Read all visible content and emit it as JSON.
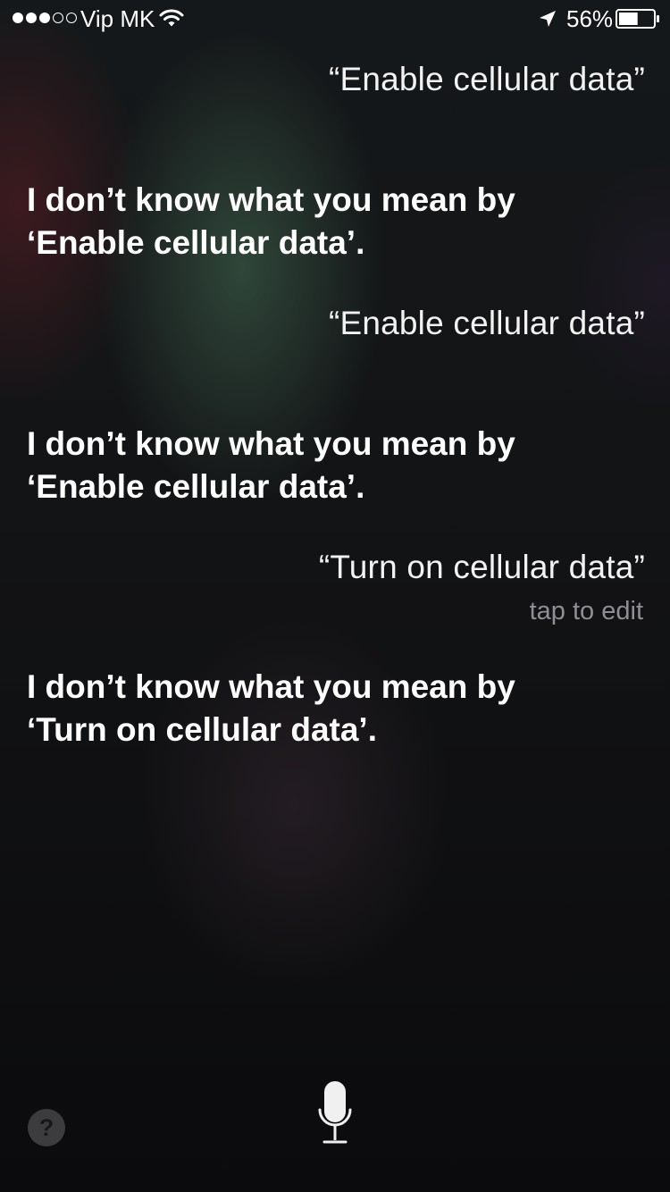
{
  "status_bar": {
    "signal_full": 3,
    "signal_total": 5,
    "carrier": "Vip MK",
    "battery_percent_label": "56%",
    "battery_level": 0.56
  },
  "conversation": [
    {
      "type": "user",
      "text": "“Enable cellular data”"
    },
    {
      "type": "siri",
      "line1": "I don’t know what you mean by",
      "line2": "‘Enable cellular data’."
    },
    {
      "type": "user",
      "text": "“Enable cellular data”"
    },
    {
      "type": "siri",
      "line1": "I don’t know what you mean by",
      "line2": "‘Enable cellular data’."
    },
    {
      "type": "user",
      "text": "“Turn on cellular data”",
      "edit_hint": "tap to edit"
    },
    {
      "type": "siri",
      "line1": "I don’t know what you mean by",
      "line2": "‘Turn on cellular data’."
    }
  ],
  "bottom": {
    "help_label": "?",
    "mic_icon": "microphone-icon"
  },
  "colors": {
    "text_primary": "#ffffff",
    "text_hint": "#8e8e93"
  }
}
